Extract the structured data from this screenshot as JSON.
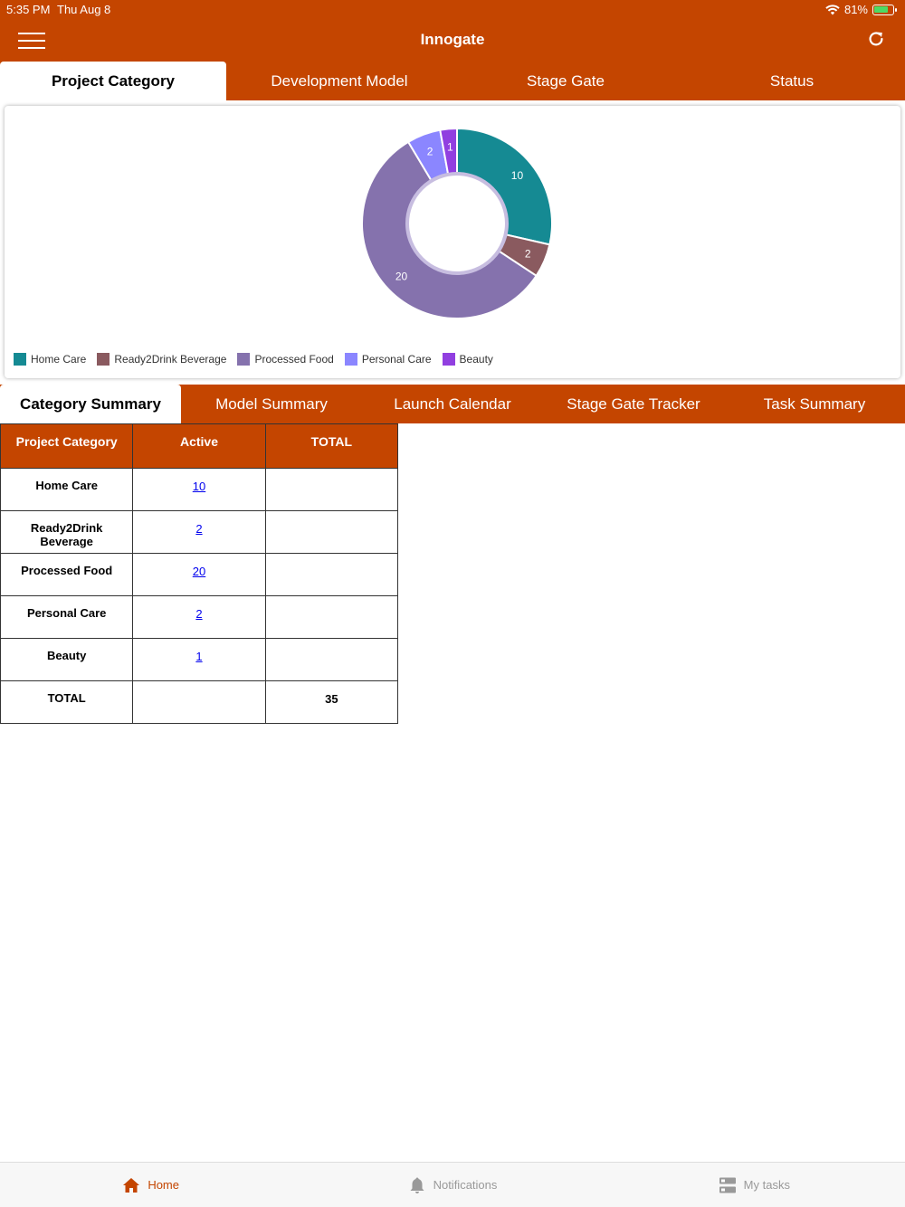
{
  "status": {
    "time": "5:35 PM",
    "date": "Thu Aug 8",
    "battery": "81%",
    "battery_level": 0.81
  },
  "header": {
    "title": "Innogate",
    "menu_icon": "hamburger-icon",
    "refresh_icon": "refresh-icon"
  },
  "top_tabs": [
    {
      "label": "Project Category"
    },
    {
      "label": "Development Model"
    },
    {
      "label": "Stage Gate"
    },
    {
      "label": "Status"
    }
  ],
  "chart_data": {
    "type": "pie",
    "donut": true,
    "categories": [
      "Home Care",
      "Ready2Drink Beverage",
      "Processed Food",
      "Personal Care",
      "Beauty"
    ],
    "values": [
      10,
      2,
      20,
      2,
      1
    ],
    "colors": [
      "#158a93",
      "#8a5a5f",
      "#8572ad",
      "#8b86ff",
      "#913fe0"
    ],
    "legend_position": "bottom-left",
    "data_labels": true
  },
  "summary_tabs": [
    {
      "label": "Category Summary"
    },
    {
      "label": "Model Summary"
    },
    {
      "label": "Launch Calendar"
    },
    {
      "label": "Stage Gate Tracker"
    },
    {
      "label": "Task Summary"
    }
  ],
  "table": {
    "headers": [
      "Project Category",
      "Active",
      "TOTAL"
    ],
    "rows": [
      {
        "category": "Home Care",
        "active": "10",
        "total": ""
      },
      {
        "category": "Ready2Drink Beverage",
        "active": "2",
        "total": ""
      },
      {
        "category": "Processed Food",
        "active": "20",
        "total": ""
      },
      {
        "category": "Personal Care",
        "active": "2",
        "total": ""
      },
      {
        "category": "Beauty",
        "active": "1",
        "total": ""
      },
      {
        "category": "TOTAL",
        "active": "",
        "total": "35"
      }
    ]
  },
  "bottom_nav": [
    {
      "label": "Home",
      "icon": "home-icon"
    },
    {
      "label": "Notifications",
      "icon": "bell-icon"
    },
    {
      "label": "My tasks",
      "icon": "tasks-icon"
    }
  ],
  "colors": {
    "brand": "#c44500",
    "link": "#0000ee"
  }
}
